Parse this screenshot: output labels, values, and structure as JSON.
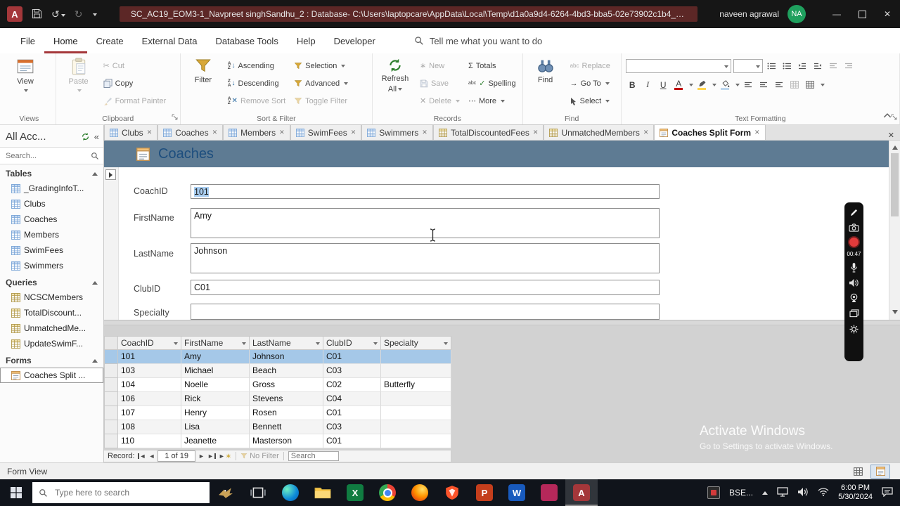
{
  "icons": {
    "app_letter": "A",
    "word_letter": "W",
    "excel_letter": "X",
    "powerpoint_letter": "P",
    "minimize": "—",
    "close": "✕",
    "undo": "↺",
    "redo": "↻",
    "collapse_panel": "«",
    "first": "◄",
    "prev": "◄",
    "next": "►",
    "last": "►",
    "new_record": "∗",
    "sigma": "Σ",
    "more": "⋯",
    "goto_arrow": "→",
    "scissors": "✂",
    "spell_abc": "abc",
    "check": "✓",
    "letter_a": "A",
    "letter_z": "Z",
    "arrow_down": "↓"
  },
  "titlebar": {
    "title": "SC_AC19_EOM3-1_Navpreet singhSandhu_2 : Database- C:\\Users\\laptopcare\\AppData\\Local\\Temp\\d1a0a9d4-6264-4bd3-bba5-02e73902c1b4_SC_A...",
    "user_name": "naveen agrawal",
    "user_initials": "NA"
  },
  "menubar": {
    "items": [
      "File",
      "Home",
      "Create",
      "External Data",
      "Database Tools",
      "Help",
      "Developer"
    ],
    "tell_me": "Tell me what you want to do"
  },
  "ribbon": {
    "views": {
      "caption": "Views",
      "view": "View"
    },
    "clipboard": {
      "caption": "Clipboard",
      "paste": "Paste",
      "cut": "Cut",
      "copy": "Copy",
      "format_painter": "Format Painter"
    },
    "sort_filter": {
      "caption": "Sort & Filter",
      "filter": "Filter",
      "ascending": "Ascending",
      "descending": "Descending",
      "remove_sort": "Remove Sort",
      "selection": "Selection",
      "advanced": "Advanced",
      "toggle_filter": "Toggle Filter"
    },
    "records": {
      "caption": "Records",
      "refresh_line1": "Refresh",
      "refresh_line2": "All",
      "new": "New",
      "save": "Save",
      "delete": "Delete",
      "totals": "Totals",
      "spelling": "Spelling",
      "more": "More"
    },
    "find": {
      "caption": "Find",
      "find": "Find",
      "replace": "Replace",
      "go_to": "Go To",
      "select": "Select"
    },
    "text_formatting": {
      "caption": "Text Formatting",
      "bold": "B",
      "italic": "I",
      "underline": "U",
      "font_color": "A"
    }
  },
  "doc_tabs": [
    "Clubs",
    "Coaches",
    "Members",
    "SwimFees",
    "Swimmers",
    "TotalDiscountedFees",
    "UnmatchedMembers",
    "Coaches Split Form"
  ],
  "sidebar": {
    "title": "All Acc...",
    "search_placeholder": "Search...",
    "tables_label": "Tables",
    "tables": [
      "_GradingInfoT...",
      "Clubs",
      "Coaches",
      "Members",
      "SwimFees",
      "Swimmers"
    ],
    "queries_label": "Queries",
    "queries": [
      "NCSCMembers",
      "TotalDiscount...",
      "UnmatchedMe...",
      "UpdateSwimF..."
    ],
    "forms_label": "Forms",
    "forms": [
      "Coaches Split ..."
    ]
  },
  "form": {
    "title": "Coaches",
    "fields": [
      {
        "label": "CoachID",
        "value": "101"
      },
      {
        "label": "FirstName",
        "value": "Amy"
      },
      {
        "label": "LastName",
        "value": "Johnson"
      },
      {
        "label": "ClubID",
        "value": "C01"
      },
      {
        "label": "Specialty",
        "value": ""
      }
    ]
  },
  "datasheet": {
    "columns": [
      "CoachID",
      "FirstName",
      "LastName",
      "ClubID",
      "Specialty"
    ],
    "rows": [
      [
        "101",
        "Amy",
        "Johnson",
        "C01",
        ""
      ],
      [
        "103",
        "Michael",
        "Beach",
        "C03",
        ""
      ],
      [
        "104",
        "Noelle",
        "Gross",
        "C02",
        "Butterfly"
      ],
      [
        "106",
        "Rick",
        "Stevens",
        "C04",
        ""
      ],
      [
        "107",
        "Henry",
        "Rosen",
        "C01",
        ""
      ],
      [
        "108",
        "Lisa",
        "Bennett",
        "C03",
        ""
      ],
      [
        "110",
        "Jeanette",
        "Masterson",
        "C01",
        ""
      ]
    ]
  },
  "record_nav": {
    "label": "Record:",
    "position": "1 of 19",
    "no_filter": "No Filter",
    "search_placeholder": "Search"
  },
  "status_bar": {
    "text": "Form View"
  },
  "taskbar": {
    "search_placeholder": "Type here to search",
    "tray_label": "BSE...",
    "time": "6:00 PM",
    "date": "5/30/2024"
  },
  "recorder": {
    "timer": "00:47"
  },
  "watermark": {
    "line1": "Activate Windows",
    "line2": "Go to Settings to activate Windows."
  }
}
